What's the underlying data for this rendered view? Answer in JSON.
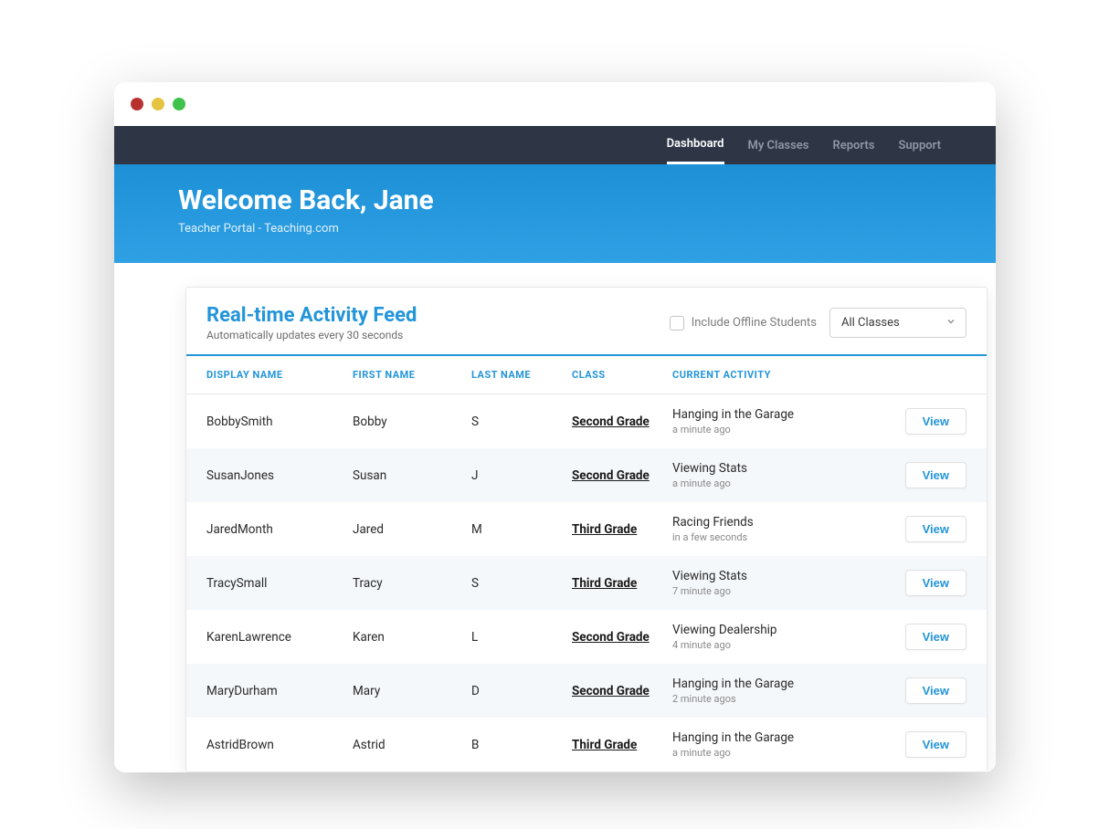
{
  "nav": {
    "items": [
      "Dashboard",
      "My Classes",
      "Reports",
      "Support"
    ],
    "active": "Dashboard"
  },
  "hero": {
    "title": "Welcome Back, Jane",
    "subtitle": "Teacher Portal - Teaching.com"
  },
  "feed": {
    "title": "Real-time Activity Feed",
    "subtitle": "Automatically updates every 30 seconds",
    "include_offline_label": "Include Offline Students",
    "class_filter": "All Classes",
    "columns": {
      "display": "DISPLAY NAME",
      "first": "FIRST NAME",
      "last": "LAST NAME",
      "class": "CLASS",
      "activity": "CURRENT ACTIVITY"
    },
    "view_label": "View",
    "rows": [
      {
        "display": "BobbySmith",
        "first": "Bobby",
        "last": "S",
        "class": "Second Grade",
        "activity": "Hanging in the Garage",
        "time": "a minute ago"
      },
      {
        "display": "SusanJones",
        "first": "Susan",
        "last": "J",
        "class": "Second Grade",
        "activity": "Viewing Stats",
        "time": "a minute ago"
      },
      {
        "display": "JaredMonth",
        "first": "Jared",
        "last": "M",
        "class": "Third Grade",
        "activity": "Racing Friends",
        "time": "in a few seconds"
      },
      {
        "display": "TracySmall",
        "first": "Tracy",
        "last": "S",
        "class": "Third Grade",
        "activity": "Viewing Stats",
        "time": "7 minute ago"
      },
      {
        "display": "KarenLawrence",
        "first": "Karen",
        "last": "L",
        "class": "Second Grade",
        "activity": "Viewing Dealership",
        "time": "4 minute ago"
      },
      {
        "display": "MaryDurham",
        "first": "Mary",
        "last": "D",
        "class": "Second Grade",
        "activity": "Hanging in the Garage",
        "time": "2 minute agos"
      },
      {
        "display": "AstridBrown",
        "first": "Astrid",
        "last": "B",
        "class": "Third Grade",
        "activity": "Hanging in the Garage",
        "time": "a minute ago"
      }
    ]
  }
}
